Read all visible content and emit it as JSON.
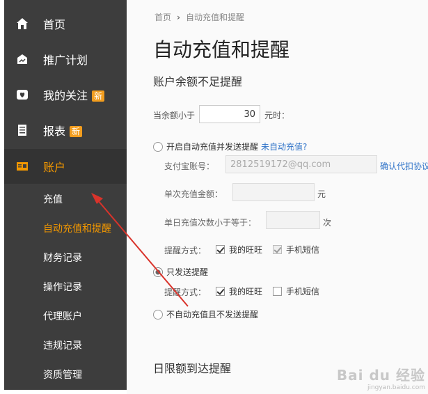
{
  "sidebar": {
    "items": [
      {
        "label": "首页",
        "icon": "home-icon",
        "badge": ""
      },
      {
        "label": "推广计划",
        "icon": "promotion-plan-icon",
        "badge": ""
      },
      {
        "label": "我的关注",
        "icon": "heart-icon",
        "badge": "新"
      },
      {
        "label": "报表",
        "icon": "report-icon",
        "badge": "新"
      },
      {
        "label": "账户",
        "icon": "account-icon",
        "badge": ""
      }
    ],
    "sub_items": [
      {
        "label": "充值"
      },
      {
        "label": "自动充值和提醒"
      },
      {
        "label": "财务记录"
      },
      {
        "label": "操作记录"
      },
      {
        "label": "代理账户"
      },
      {
        "label": "违规记录"
      },
      {
        "label": "资质管理"
      }
    ]
  },
  "breadcrumb": {
    "home": "首页",
    "current": "自动充值和提醒"
  },
  "page_title": "自动充值和提醒",
  "balance_section": {
    "title": "账户余额不足提醒",
    "threshold_prefix": "当余额小于",
    "threshold_value": "30",
    "threshold_suffix": "元时："
  },
  "option_auto": {
    "label": "开启自动充值并发送提醒",
    "link": "未自动充值?",
    "alipay_label": "支付宝账号：",
    "alipay_value": "2812519172@qq.com",
    "alipay_link": "确认代扣协议",
    "amount_label": "单次充值金额：",
    "amount_unit": "元",
    "count_label": "单日充值次数小于等于：",
    "count_unit": "次",
    "notify_label": "提醒方式：",
    "notify_wangwang": "我的旺旺",
    "notify_sms": "手机短信"
  },
  "option_remind": {
    "label": "只发送提醒",
    "notify_label": "提醒方式：",
    "notify_wangwang": "我的旺旺",
    "notify_sms": "手机短信"
  },
  "option_none": {
    "label": "不自动充值且不发送提醒"
  },
  "daily_section": {
    "title": "日限额到达提醒"
  },
  "watermark": {
    "logo": "Bai du 经验",
    "url": "jingyan.baidu.com"
  },
  "colors": {
    "sidebar_bg": "#3d3d3d",
    "accent": "#f39800",
    "badge": "#f29d1e",
    "link": "#2f73c8",
    "arrow": "#d9332b"
  }
}
